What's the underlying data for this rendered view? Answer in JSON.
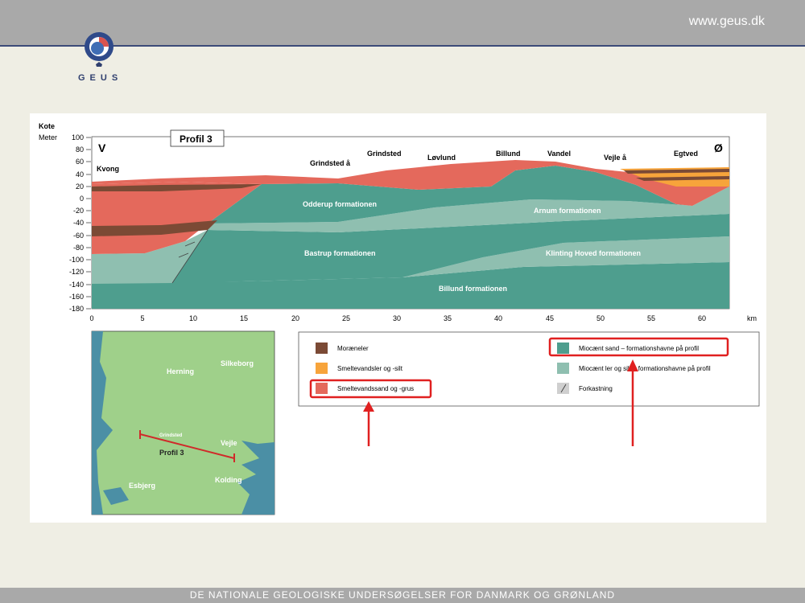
{
  "header": {
    "url": "www.geus.dk",
    "logo_text": "GEUS"
  },
  "footer": {
    "text": "DE NATIONALE GEOLOGISKE UNDERSØGELSER FOR DANMARK OG GRØNLAND"
  },
  "profile": {
    "title": "Profil 3",
    "ylabel_top": "Kote",
    "ylabel_bottom": "Meter",
    "x_unit": "km",
    "west": "V",
    "east": "Ø",
    "y_ticks": [
      "100",
      "80",
      "60",
      "40",
      "20",
      "0",
      "-20",
      "-40",
      "-60",
      "-80",
      "-100",
      "-120",
      "-140",
      "-160",
      "-180"
    ],
    "x_ticks": [
      "0",
      "5",
      "10",
      "15",
      "20",
      "25",
      "30",
      "35",
      "40",
      "45",
      "50",
      "55",
      "60"
    ],
    "places": [
      "Kvong",
      "Grindsted å",
      "Grindsted",
      "Løvlund",
      "Billund",
      "Vandel",
      "Vejle å",
      "Egtved"
    ],
    "formations": [
      "Odderup formationen",
      "Arnum formationen",
      "Bastrup formationen",
      "Klinting Hoved formationen",
      "Billund formationen"
    ]
  },
  "legend": {
    "items": [
      "Moræneler",
      "Smeltevandsler og -silt",
      "Smeltevandssand og -grus",
      "Miocænt sand – formationshavne på profil",
      "Miocænt ler og silt – formationshavne på profil",
      "Forkastning"
    ],
    "colors": {
      "moraeneler": "#7b4a35",
      "smeltevandsler": "#f7a43b",
      "smeltevandssand": "#e4695c",
      "mio_sand": "#4e9e8e",
      "mio_ler": "#8fbfb0",
      "forkastning": "#cfcfcf",
      "highlight": "#e02020"
    }
  },
  "map": {
    "labels": [
      "Herning",
      "Silkeborg",
      "Grindsted",
      "Profil 3",
      "Vejle",
      "Esbjerg",
      "Kolding"
    ],
    "colors": {
      "land": "#9fd08a",
      "sea": "#4b8fa5",
      "profile_line": "#d02a2a"
    }
  }
}
